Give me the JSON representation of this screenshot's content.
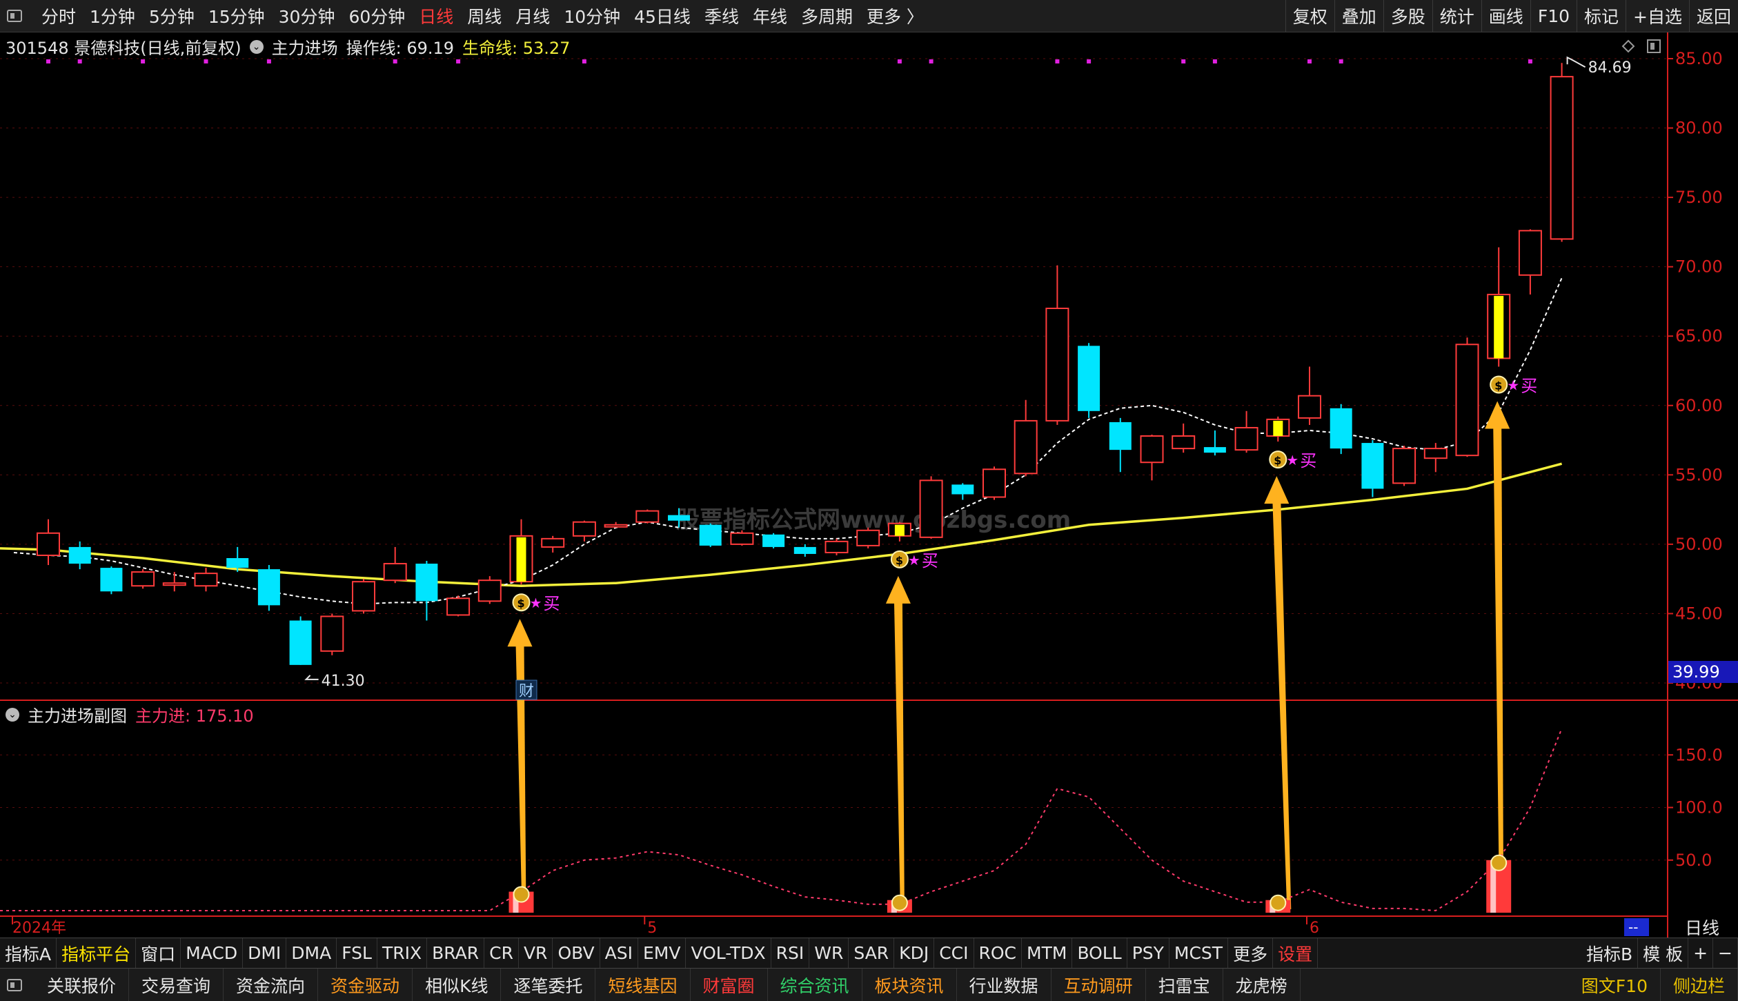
{
  "topbar": {
    "periods": [
      "分时",
      "1分钟",
      "5分钟",
      "15分钟",
      "30分钟",
      "60分钟",
      "日线",
      "周线",
      "月线",
      "10分钟",
      "45日线",
      "季线",
      "年线",
      "多周期",
      "更多 〉"
    ],
    "active_period": "日线",
    "right_buttons": [
      "复权",
      "叠加",
      "多股",
      "统计",
      "画线",
      "F10",
      "标记",
      "+自选",
      "返回"
    ]
  },
  "main_info": {
    "stock": "301548 景德科技(日线,前复权)",
    "indicator_name": "主力进场",
    "op_line": "操作线: 69.19",
    "life_line": "生命线: 53.27"
  },
  "sub_info": {
    "name": "主力进场副图",
    "value": "主力进: 175.10"
  },
  "watermark": "股票指标公式网www.gpzbgs.com",
  "colors": {
    "up": "#ff3b3b",
    "down": "#00e5ff",
    "life": "#f2ef3b",
    "op": "#ffffff",
    "arrow": "#ffb21f",
    "signal": "#ffff00",
    "axis": "#d81e1e"
  },
  "chart_data": [
    {
      "type": "candlestick",
      "title": "301548 景德科技(日线,前复权)",
      "ylim": [
        40,
        85
      ],
      "y_ticks": [
        "85.00",
        "80.00",
        "75.00",
        "70.00",
        "65.00",
        "60.00",
        "55.00",
        "50.00",
        "45.00",
        "40.00"
      ],
      "current_price_tag": "39.99",
      "low_label": "41.30",
      "high_label": "84.69",
      "x_labels": [
        {
          "index": 0,
          "text": "2024年"
        },
        {
          "index": 19,
          "text": "5"
        },
        {
          "index": 40,
          "text": "6"
        }
      ],
      "candles": [
        [
          0,
          49.2,
          50.8,
          48.5,
          51.8
        ],
        [
          1,
          49.8,
          48.6,
          48.2,
          50.2
        ],
        [
          2,
          48.3,
          46.6,
          46.4,
          48.4
        ],
        [
          3,
          47.0,
          48.0,
          46.8,
          48.2
        ],
        [
          4,
          47.2,
          47.2,
          46.6,
          48.0
        ],
        [
          5,
          47.0,
          47.9,
          46.6,
          48.3
        ],
        [
          6,
          49.0,
          48.3,
          48.0,
          49.8
        ],
        [
          7,
          48.2,
          45.6,
          45.2,
          48.5
        ],
        [
          8,
          44.5,
          41.3,
          41.3,
          44.8
        ],
        [
          9,
          42.3,
          44.8,
          42.0,
          45.0
        ],
        [
          10,
          45.2,
          47.3,
          45.0,
          47.5
        ],
        [
          11,
          47.4,
          48.6,
          47.2,
          49.8
        ],
        [
          12,
          48.6,
          45.9,
          44.5,
          48.8
        ],
        [
          13,
          44.9,
          46.1,
          44.8,
          46.3
        ],
        [
          14,
          45.9,
          47.4,
          45.7,
          47.7
        ],
        [
          15,
          47.3,
          50.6,
          47.1,
          51.8
        ],
        [
          16,
          49.8,
          50.4,
          49.4,
          50.6
        ],
        [
          17,
          50.6,
          51.6,
          50.2,
          51.7
        ],
        [
          18,
          51.4,
          51.4,
          51.2,
          51.6
        ],
        [
          19,
          51.6,
          52.4,
          51.5,
          52.5
        ],
        [
          20,
          52.1,
          51.7,
          51.2,
          52.6
        ],
        [
          21,
          51.4,
          49.9,
          49.8,
          51.5
        ],
        [
          22,
          50.0,
          50.8,
          49.9,
          51.0
        ],
        [
          23,
          50.7,
          49.8,
          49.7,
          50.8
        ],
        [
          24,
          49.8,
          49.3,
          49.1,
          50.0
        ],
        [
          25,
          49.4,
          50.2,
          49.2,
          50.4
        ],
        [
          26,
          49.9,
          51.0,
          49.7,
          51.2
        ],
        [
          27,
          50.6,
          51.5,
          50.2,
          51.6
        ],
        [
          28,
          50.5,
          54.6,
          50.4,
          54.9
        ],
        [
          29,
          54.3,
          53.6,
          53.2,
          54.4
        ],
        [
          30,
          53.4,
          55.4,
          53.2,
          55.6
        ],
        [
          31,
          55.1,
          58.9,
          54.9,
          60.4
        ],
        [
          32,
          58.9,
          67.0,
          58.6,
          70.1
        ],
        [
          33,
          64.3,
          59.6,
          59.1,
          64.5
        ],
        [
          34,
          58.8,
          56.8,
          55.2,
          59.1
        ],
        [
          35,
          55.9,
          57.8,
          54.6,
          57.9
        ],
        [
          36,
          56.9,
          57.8,
          56.6,
          58.7
        ],
        [
          37,
          57.0,
          56.6,
          56.4,
          58.2
        ],
        [
          38,
          56.8,
          58.4,
          56.6,
          59.6
        ],
        [
          39,
          57.8,
          59.0,
          57.4,
          59.2
        ],
        [
          40,
          59.1,
          60.7,
          58.6,
          62.8
        ],
        [
          41,
          59.8,
          56.9,
          56.5,
          60.1
        ],
        [
          42,
          57.3,
          54.0,
          53.4,
          57.5
        ],
        [
          43,
          54.4,
          56.9,
          54.2,
          57.1
        ],
        [
          44,
          56.2,
          56.9,
          55.2,
          57.3
        ],
        [
          45,
          56.4,
          64.4,
          56.3,
          64.9
        ],
        [
          46,
          63.4,
          68.0,
          62.8,
          71.4
        ],
        [
          47,
          69.4,
          72.6,
          68.0,
          72.7
        ],
        [
          48,
          72.0,
          83.7,
          71.8,
          84.69
        ]
      ],
      "op_line": [
        [
          0,
          49.2
        ],
        [
          1,
          49.1
        ],
        [
          2,
          48.8
        ],
        [
          3,
          48.3
        ],
        [
          4,
          47.8
        ],
        [
          5,
          47.4
        ],
        [
          6,
          47.0
        ],
        [
          7,
          46.6
        ],
        [
          8,
          46.2
        ],
        [
          9,
          45.9
        ],
        [
          10,
          45.7
        ],
        [
          11,
          45.8
        ],
        [
          12,
          45.8
        ],
        [
          13,
          46.2
        ],
        [
          14,
          46.8
        ],
        [
          15,
          47.4
        ],
        [
          16,
          48.5
        ],
        [
          17,
          50.0
        ],
        [
          18,
          51.2
        ],
        [
          19,
          51.6
        ],
        [
          20,
          51.2
        ],
        [
          21,
          51.0
        ],
        [
          22,
          50.8
        ],
        [
          23,
          50.6
        ],
        [
          24,
          50.4
        ],
        [
          25,
          50.4
        ],
        [
          26,
          50.6
        ],
        [
          27,
          50.8
        ],
        [
          28,
          51.4
        ],
        [
          29,
          52.6
        ],
        [
          30,
          53.6
        ],
        [
          31,
          55.0
        ],
        [
          32,
          57.3
        ],
        [
          33,
          59.0
        ],
        [
          34,
          59.8
        ],
        [
          35,
          60.0
        ],
        [
          36,
          59.5
        ],
        [
          37,
          58.6
        ],
        [
          38,
          58.0
        ],
        [
          39,
          58.0
        ],
        [
          40,
          58.2
        ],
        [
          41,
          58.0
        ],
        [
          42,
          57.6
        ],
        [
          43,
          57.0
        ],
        [
          44,
          56.8
        ],
        [
          45,
          57.4
        ],
        [
          46,
          59.5
        ],
        [
          47,
          64.0
        ],
        [
          48,
          69.19
        ]
      ],
      "life_line": [
        [
          0,
          49.6
        ],
        [
          3,
          49.0
        ],
        [
          6,
          48.2
        ],
        [
          9,
          47.7
        ],
        [
          12,
          47.3
        ],
        [
          15,
          47.0
        ],
        [
          18,
          47.2
        ],
        [
          21,
          47.8
        ],
        [
          24,
          48.5
        ],
        [
          27,
          49.3
        ],
        [
          30,
          50.3
        ],
        [
          33,
          51.4
        ],
        [
          36,
          51.9
        ],
        [
          39,
          52.5
        ],
        [
          42,
          53.2
        ],
        [
          45,
          54.0
        ],
        [
          48,
          55.8
        ]
      ],
      "signals": [
        15,
        27,
        39,
        46
      ]
    },
    {
      "type": "line",
      "title": "主力进场副图",
      "ylim": [
        0,
        200
      ],
      "y_ticks": [
        "150.0",
        "100.0",
        "50.0"
      ],
      "series": [
        {
          "name": "主力进",
          "values": [
            [
              0,
              2
            ],
            [
              14,
              2
            ],
            [
              15,
              20
            ],
            [
              16,
              40
            ],
            [
              17,
              50
            ],
            [
              18,
              52
            ],
            [
              19,
              58
            ],
            [
              20,
              55
            ],
            [
              21,
              45
            ],
            [
              22,
              36
            ],
            [
              23,
              25
            ],
            [
              24,
              15
            ],
            [
              25,
              12
            ],
            [
              26,
              8
            ],
            [
              27,
              8
            ],
            [
              28,
              20
            ],
            [
              29,
              30
            ],
            [
              30,
              40
            ],
            [
              31,
              65
            ],
            [
              32,
              118
            ],
            [
              33,
              110
            ],
            [
              34,
              80
            ],
            [
              35,
              50
            ],
            [
              36,
              30
            ],
            [
              37,
              20
            ],
            [
              38,
              10
            ],
            [
              39,
              10
            ],
            [
              40,
              22
            ],
            [
              41,
              10
            ],
            [
              42,
              4
            ],
            [
              43,
              4
            ],
            [
              44,
              2
            ],
            [
              45,
              20
            ],
            [
              46,
              50
            ],
            [
              47,
              100
            ],
            [
              48,
              175.1
            ]
          ]
        }
      ],
      "bars": [
        15,
        27,
        39,
        46
      ]
    }
  ],
  "annotations": {
    "buy_label": "买",
    "star": "★",
    "money_bag": "$",
    "cai_tag": "财",
    "dash_tag": "--",
    "period_tag": "日线"
  },
  "indicator_tabs": [
    "指标A",
    "指标平台",
    "窗口",
    "MACD",
    "DMI",
    "DMA",
    "FSL",
    "TRIX",
    "BRAR",
    "CR",
    "VR",
    "OBV",
    "ASI",
    "EMV",
    "VOL-TDX",
    "RSI",
    "WR",
    "SAR",
    "KDJ",
    "CCI",
    "ROC",
    "MTM",
    "BOLL",
    "PSY",
    "MCST",
    "更多",
    "设置"
  ],
  "indicator_tabs_right": [
    "指标B",
    "模 板",
    "+",
    "−"
  ],
  "bottom_tabs": [
    "关联报价",
    "交易查询",
    "资金流向",
    "资金驱动",
    "相似K线",
    "逐笔委托",
    "短线基因",
    "财富圈",
    "综合资讯",
    "板块资讯",
    "行业数据",
    "互动调研",
    "扫雷宝",
    "龙虎榜"
  ],
  "bottom_right": [
    "图文F10",
    "侧边栏"
  ]
}
